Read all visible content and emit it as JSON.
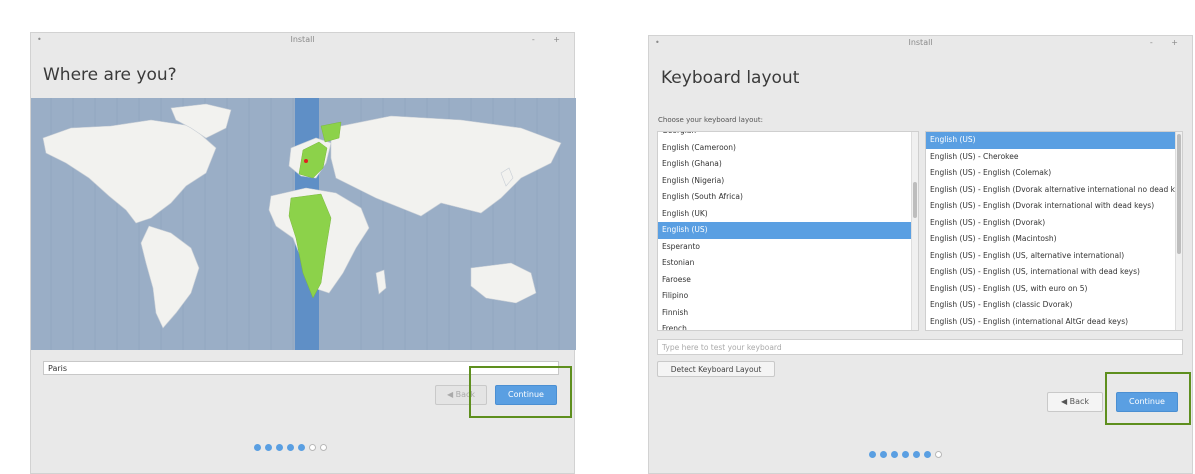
{
  "left_window": {
    "title": "Install",
    "controls": "- +",
    "menu_glyph": "•",
    "heading": "Where are you?",
    "timezone_value": "Paris",
    "back_label": "Back",
    "continue_label": "Continue",
    "progress": {
      "total": 7,
      "completed": 5
    }
  },
  "right_window": {
    "title": "Install",
    "controls": "- +",
    "menu_glyph": "•",
    "heading": "Keyboard layout",
    "choose_label": "Choose your keyboard layout:",
    "layouts": [
      "Georgian",
      "English (Cameroon)",
      "English (Ghana)",
      "English (Nigeria)",
      "English (South Africa)",
      "English (UK)",
      "English (US)",
      "Esperanto",
      "Estonian",
      "Faroese",
      "Filipino",
      "Finnish",
      "French"
    ],
    "selected_layout": "English (US)",
    "variants": [
      "English (US)",
      "English (US) - Cherokee",
      "English (US) - English (Colemak)",
      "English (US) - English (Dvorak alternative international no dead keys)",
      "English (US) - English (Dvorak international with dead keys)",
      "English (US) - English (Dvorak)",
      "English (US) - English (Macintosh)",
      "English (US) - English (US, alternative international)",
      "English (US) - English (US, international with dead keys)",
      "English (US) - English (US, with euro on 5)",
      "English (US) - English (classic Dvorak)",
      "English (US) - English (international AltGr dead keys)"
    ],
    "selected_variant": "English (US)",
    "test_placeholder": "Type here to test your keyboard",
    "detect_label": "Detect Keyboard Layout",
    "back_label": "Back",
    "continue_label": "Continue",
    "progress": {
      "total": 7,
      "completed": 6
    }
  },
  "colors": {
    "accent": "#5a9fe2",
    "highlight_box": "#5e8f1e",
    "map_ocean": "#9aaec6",
    "map_land": "#f2f2ef",
    "timezone_band": "#5f8fc6",
    "timezone_region": "#8cd24a"
  }
}
